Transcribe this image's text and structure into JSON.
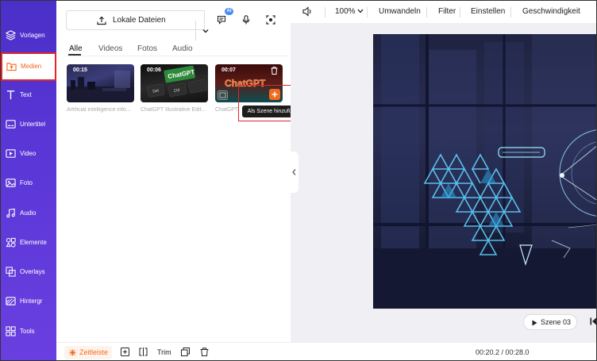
{
  "sidebar": {
    "items": [
      {
        "label": "Vorlagen",
        "icon": "layers-icon"
      },
      {
        "label": "Medien",
        "icon": "media-upload-icon",
        "active": true
      },
      {
        "label": "Text",
        "icon": "text-icon"
      },
      {
        "label": "Untertitel",
        "icon": "subtitle-icon"
      },
      {
        "label": "Video",
        "icon": "video-icon"
      },
      {
        "label": "Foto",
        "icon": "photo-icon"
      },
      {
        "label": "Audio",
        "icon": "music-icon"
      },
      {
        "label": "Elemente",
        "icon": "elements-icon"
      },
      {
        "label": "Overlays",
        "icon": "overlays-icon"
      },
      {
        "label": "Hintergr",
        "icon": "background-icon"
      },
      {
        "label": "Tools",
        "icon": "tools-icon"
      }
    ]
  },
  "media_panel": {
    "upload_label": "Lokale Dateien",
    "ai_badge": "AI",
    "tabs": [
      "Alle",
      "Videos",
      "Fotos",
      "Audio"
    ],
    "active_tab": "Alle",
    "items": [
      {
        "duration": "00:15",
        "label": "Artificial intelligence info..."
      },
      {
        "duration": "00:06",
        "label": "ChatGPT Illustrative Edit..."
      },
      {
        "duration": "00:07",
        "label": "ChatGPT"
      }
    ],
    "thumb_texts": {
      "chatgpt_key": "ChatGPT",
      "del_key": "Del",
      "ctrl_key": "Ctrl",
      "neon": "ChatGPT"
    },
    "tooltip": "Als Szene hinzufügen"
  },
  "toolbar": {
    "zoom": "100%",
    "items": [
      "Umwandeln",
      "Filter",
      "Einstellen",
      "Geschwindigkeit"
    ]
  },
  "preview": {
    "scene_label": "Szene 03"
  },
  "bottom_bar": {
    "timeline_label": "Zeitleiste",
    "trim_label": "Trim",
    "time": "00:20.2 / 00:28.0"
  },
  "colors": {
    "sidebar_gradient_start": "#4a2fc8",
    "accent": "#f26b1d",
    "highlight": "#e0262a"
  }
}
